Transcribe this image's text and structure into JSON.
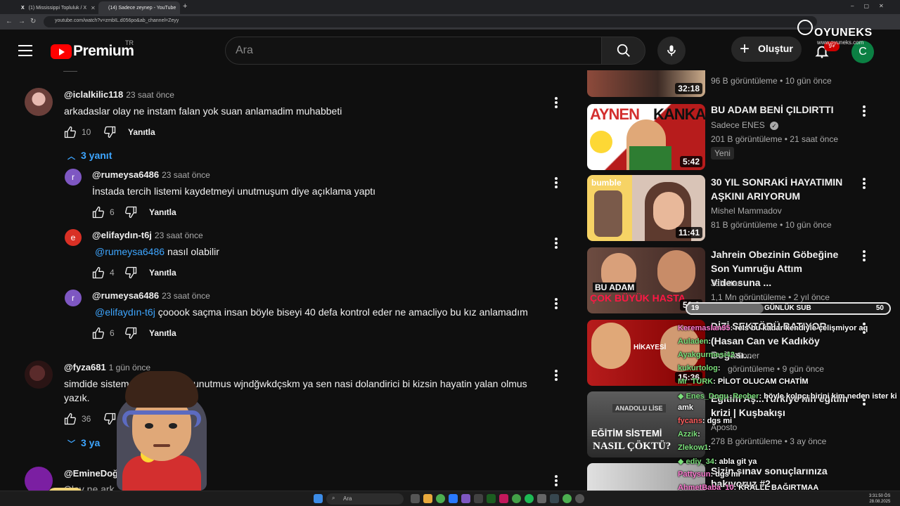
{
  "browser": {
    "tabs": [
      {
        "label": "(1) Mississippi Topluluk / X"
      },
      {
        "label": "(14) Sadece zeynep - YouTube"
      }
    ],
    "url": "youtube.com/watch?v=zmbIL.d056po&ab_channel=Zeyy"
  },
  "header": {
    "logo_text": "Premium",
    "logo_region": "TR",
    "search_placeholder": "Ara",
    "create_label": "Oluştur",
    "notification_count": "9+",
    "avatar_letter": "C"
  },
  "overlay_brand": {
    "name": "OYUNEKS",
    "url": "www.oyuneks.com"
  },
  "comments": [
    {
      "author": "@iclalkilic118",
      "time": "23 saat önce",
      "text": "arkadaslar olay ne instam falan yok suan anlamadim muhabbeti",
      "likes": "10",
      "reply": "Yanıtla",
      "replies_label": "3 yanıt"
    },
    {
      "author": "@rumeysa6486",
      "time": "23 saat önce",
      "text": "İnstada tercih listemi kaydetmeyi unutmuşum diye açıklama yaptı",
      "likes": "6",
      "reply": "Yanıtla",
      "avatar": "r"
    },
    {
      "author": "@elifaydın-t6j",
      "time": "23 saat önce",
      "mention": "@rumeysa6486",
      "text": "nasıl olabilir",
      "likes": "4",
      "reply": "Yanıtla",
      "avatar": "e"
    },
    {
      "author": "@rumeysa6486",
      "time": "23 saat önce",
      "mention": "@elifaydın-t6j",
      "text": "çooook saçma insan böyle biseyi 40 defa kontrol eder ne amacliyo bu kız anlamadım",
      "likes": "6",
      "reply": "Yanıtla",
      "avatar": "r"
    },
    {
      "author": "@fyza681",
      "time": "1 gün önce",
      "text_line1": "simdide sisteme",
      "text_line1_cont": "unutmus wjndğwkdçskm ya sen nasi dolandirici bi kizsin hayatin yalan olmus",
      "text_line2": "yazık.",
      "likes": "36",
      "replies_label": "3 ya"
    },
    {
      "author": "@EmineDoğ",
      "text": "Olay ne ark"
    }
  ],
  "sidebar": {
    "videos": [
      {
        "title": "",
        "meta": "96 B görüntüleme • 10 gün önce",
        "duration": "32:18"
      },
      {
        "title": "BU ADAM BENİ ÇILDIRTTI",
        "channel": "Sadece ENES",
        "meta": "201 B görüntüleme • 21 saat önce",
        "duration": "5:42",
        "badge": "Yeni",
        "thumb_text_a": "AYNEN",
        "thumb_text_b": "KANKA"
      },
      {
        "title": "30 YIL SONRAKİ HAYATIMIN AŞKINI ARIYORUM",
        "channel": "Mishel Mammadov",
        "meta": "81 B görüntüleme • 10 gün önce",
        "duration": "11:41",
        "thumb_text": "bumble"
      },
      {
        "title": "Jahrein Obezinin Göbeğine Son Yumruğu Attım Videosuna ...",
        "channel": "Jahistan",
        "meta": "1,1 Mn görüntüleme • 2 yıl önce",
        "duration": "56:3",
        "thumb_text_a": "BU ADAM",
        "thumb_text_b": "ÇOK BÜYÜK HASTA"
      },
      {
        "title": "DİZİ SEKTÖRÜ BATIYOR",
        "title_line2": "(Hasan Can ve Kadıköy Boğası...",
        "channel": "Soner",
        "meta": "görüntüleme • 9 gün önce",
        "duration": "15:36",
        "thumb_text": "HİKAYESİ"
      },
      {
        "title": "Eğitim Aş...Türkiye'nin eğitim",
        "title_line2": "krizi | Kuşbakışı",
        "channel": "Aposto",
        "meta": "278 B görüntüleme • 3 ay önce",
        "thumb_text_a": "EĞİTİM SİSTEMİ",
        "thumb_text_b": "NASIL ÇÖKTÜ?",
        "thumb_label": "ANADOLU LİSE"
      },
      {
        "title": "Sizin sınav sonuçlarınıza",
        "title_line2": "bakıyoruz #2"
      }
    ]
  },
  "sub_goal": {
    "current": "19",
    "label": "GÜNLÜK SUB",
    "target": "50",
    "progress": 0.38
  },
  "chat": [
    {
      "user": "Keremaslan95",
      "msg": ": rels bu kadar kendiyle çelişmiyor aq"
    },
    {
      "user": "Auladen",
      "msg": ":"
    },
    {
      "user": "Ayakgurmesi42",
      "msg": ":"
    },
    {
      "user": "kukurtolog",
      "msg": ":"
    },
    {
      "user": "Mr_TURK",
      "msg": ": PİLOT OLUCAM CHATİM"
    },
    {
      "user": "Enes_Dogu_Recber",
      "msg": ": böyle kolpçı birini kim neden ister ki"
    },
    {
      "user": "",
      "msg": "amk"
    },
    {
      "user": "fycans",
      "msg": ": dgs mi"
    },
    {
      "user": "Azzik",
      "msg": ":"
    },
    {
      "user": "Zlekow1",
      "msg": ":"
    },
    {
      "user": "ediy_34",
      "msg": ": abla git ya"
    },
    {
      "user": "Pattysun",
      "msg": ": dgs mi"
    },
    {
      "user": "AhmetBaba_10",
      "msg": ": KRALLL BAĞIRTMAA"
    }
  ],
  "taskbar": {
    "search_label": "Ara",
    "time": "3:31:50 ÖS",
    "date": "28.08.2025"
  },
  "colors": {
    "background": "#0f0f0f",
    "yt_red": "#ff0000",
    "link": "#3ea6ff",
    "avatar_green": "#0b8043"
  }
}
